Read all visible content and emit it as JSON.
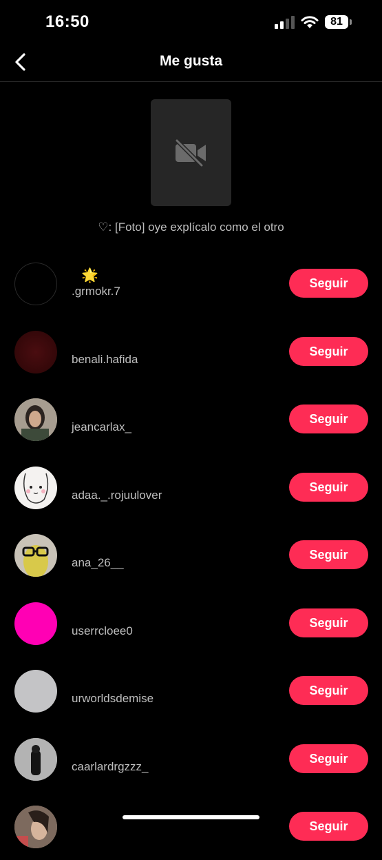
{
  "status": {
    "time": "16:50",
    "battery": "81"
  },
  "header": {
    "title": "Me gusta"
  },
  "post": {
    "caption": "♡: [Foto] oye explícalo como el otro"
  },
  "follow_label": "Seguir",
  "users": [
    {
      "username": ".grmokr.7",
      "badge": "🌟",
      "avatar_color": "#000000"
    },
    {
      "username": "benali.hafida",
      "avatar_color": "#3a0a0c"
    },
    {
      "username": "jeancarlax_",
      "avatar_color": "#7a6f66"
    },
    {
      "username": "adaa._.rojuulover",
      "avatar_color": "#f3f1ef"
    },
    {
      "username": "ana_26__",
      "avatar_color": "#b9b4aa"
    },
    {
      "username": "userrcloee0",
      "avatar_color": "#ff00b4"
    },
    {
      "username": "urworldsdemise",
      "avatar_color": "#c6c6c6"
    },
    {
      "username": "caarlardrgzzz_",
      "avatar_color": "#8a8a8a"
    },
    {
      "username": "",
      "avatar_color": "#9c8576"
    }
  ],
  "colors": {
    "accent": "#fe2c55",
    "background": "#000000"
  }
}
